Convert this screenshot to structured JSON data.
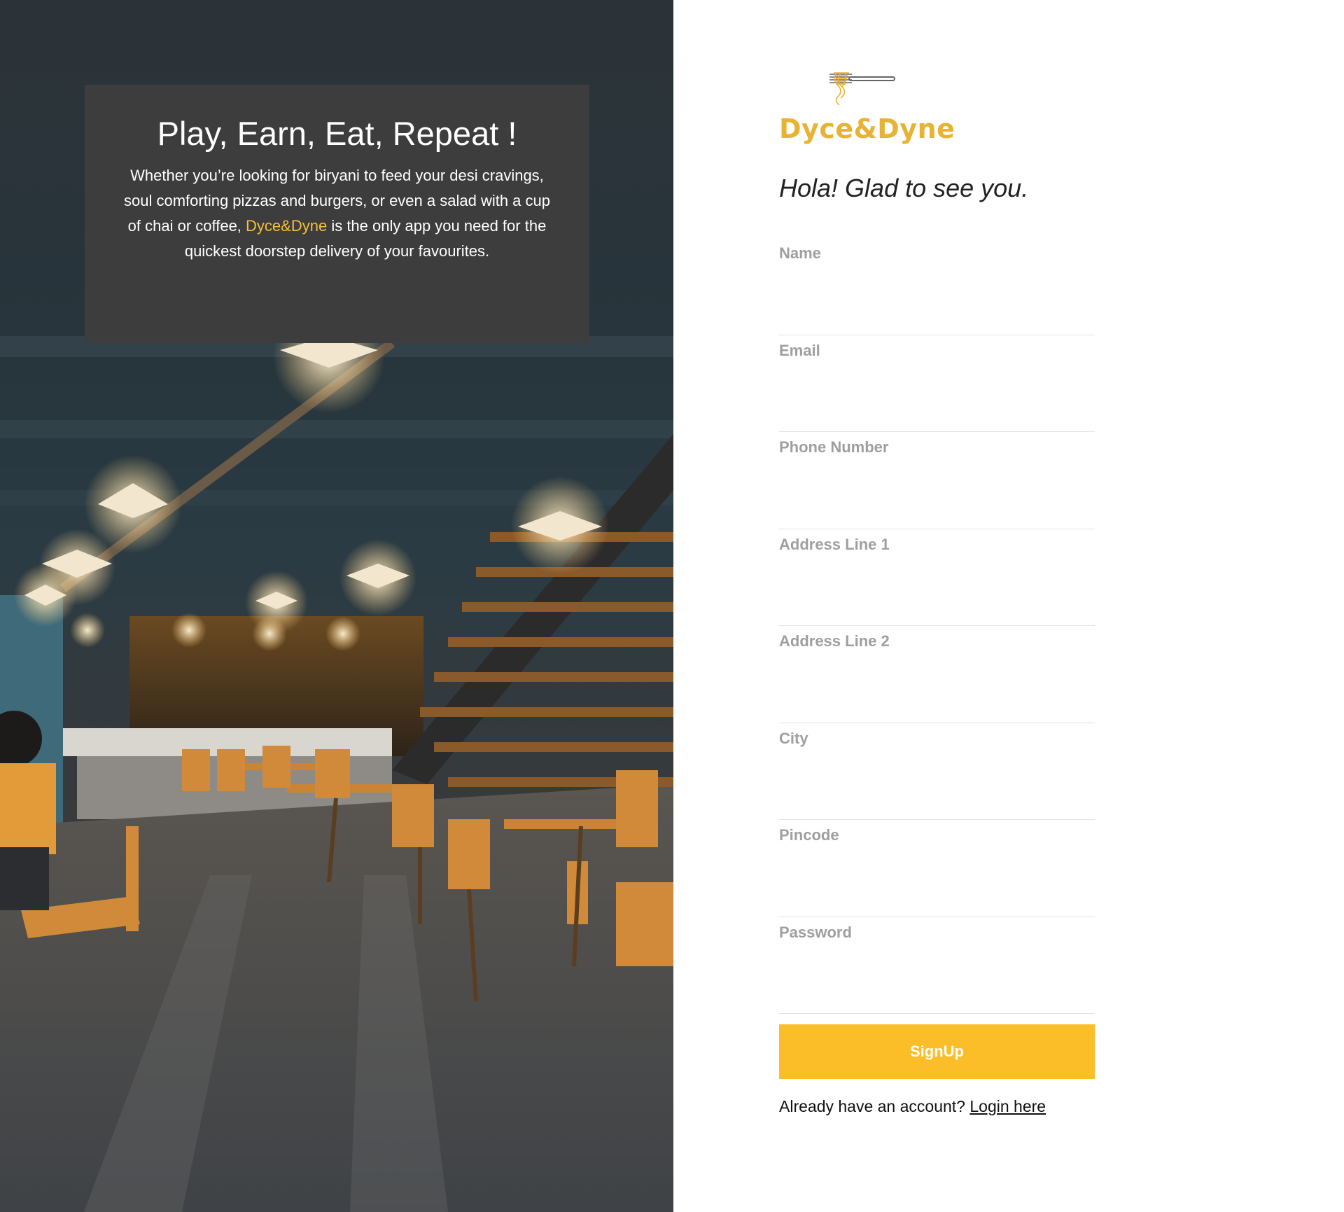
{
  "hero": {
    "title": "Play, Earn, Eat, Repeat !",
    "text_before": "Whether you’re looking for biryani to feed your desi cravings, soul comforting pizzas and burgers, or even a salad with a cup of chai or coffee, ",
    "brand": "Dyce&Dyne",
    "text_after": " is the only app you need for the quickest doorstep delivery of your favourites."
  },
  "logo": {
    "name": "Dyce&Dyne",
    "icon": "fork-noodles-icon"
  },
  "greeting": "Hola! Glad to see you.",
  "form": {
    "fields": [
      {
        "label": "Name",
        "value": ""
      },
      {
        "label": "Email",
        "value": ""
      },
      {
        "label": "Phone Number",
        "value": ""
      },
      {
        "label": "Address Line 1",
        "value": ""
      },
      {
        "label": "Address Line 2",
        "value": ""
      },
      {
        "label": "City",
        "value": ""
      },
      {
        "label": "Pincode",
        "value": ""
      },
      {
        "label": "Password",
        "value": ""
      }
    ],
    "submit_label": "SignUp"
  },
  "login": {
    "prompt": "Already have an account? ",
    "link_label": "Login here"
  },
  "colors": {
    "accent": "#fbbd28",
    "brand_text": "#e8b334",
    "hero_card": "#3d3d3d",
    "label_gray": "#9f9f9f"
  }
}
